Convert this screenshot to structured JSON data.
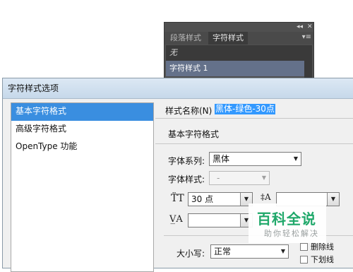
{
  "panel": {
    "controls": {
      "collapse": "◂◂",
      "close": "✕"
    },
    "tabs": [
      "段落样式",
      "字符样式"
    ],
    "menu_icon": "▾≡",
    "items": [
      "无",
      "字符样式 1"
    ]
  },
  "dialog": {
    "title": "字符样式选项",
    "sidebar": [
      "基本字符格式",
      "高级字符格式",
      "OpenType 功能"
    ],
    "style_name_label": "样式名称(N)",
    "style_name_value": "黑体-绿色-30点",
    "section_title": "基本字符格式",
    "font_family_label": "字体系列:",
    "font_family_value": "黑体",
    "font_style_label": "字体样式:",
    "font_style_value": "-",
    "size_value": "30 点",
    "leading_value": "",
    "kerning_value": "",
    "case_label": "大小写:",
    "case_value": "正常",
    "strikethrough_label": "删除线",
    "underline_label": "下划线"
  },
  "watermark": {
    "title": "百科全说",
    "subtitle": "助你轻松解决"
  }
}
